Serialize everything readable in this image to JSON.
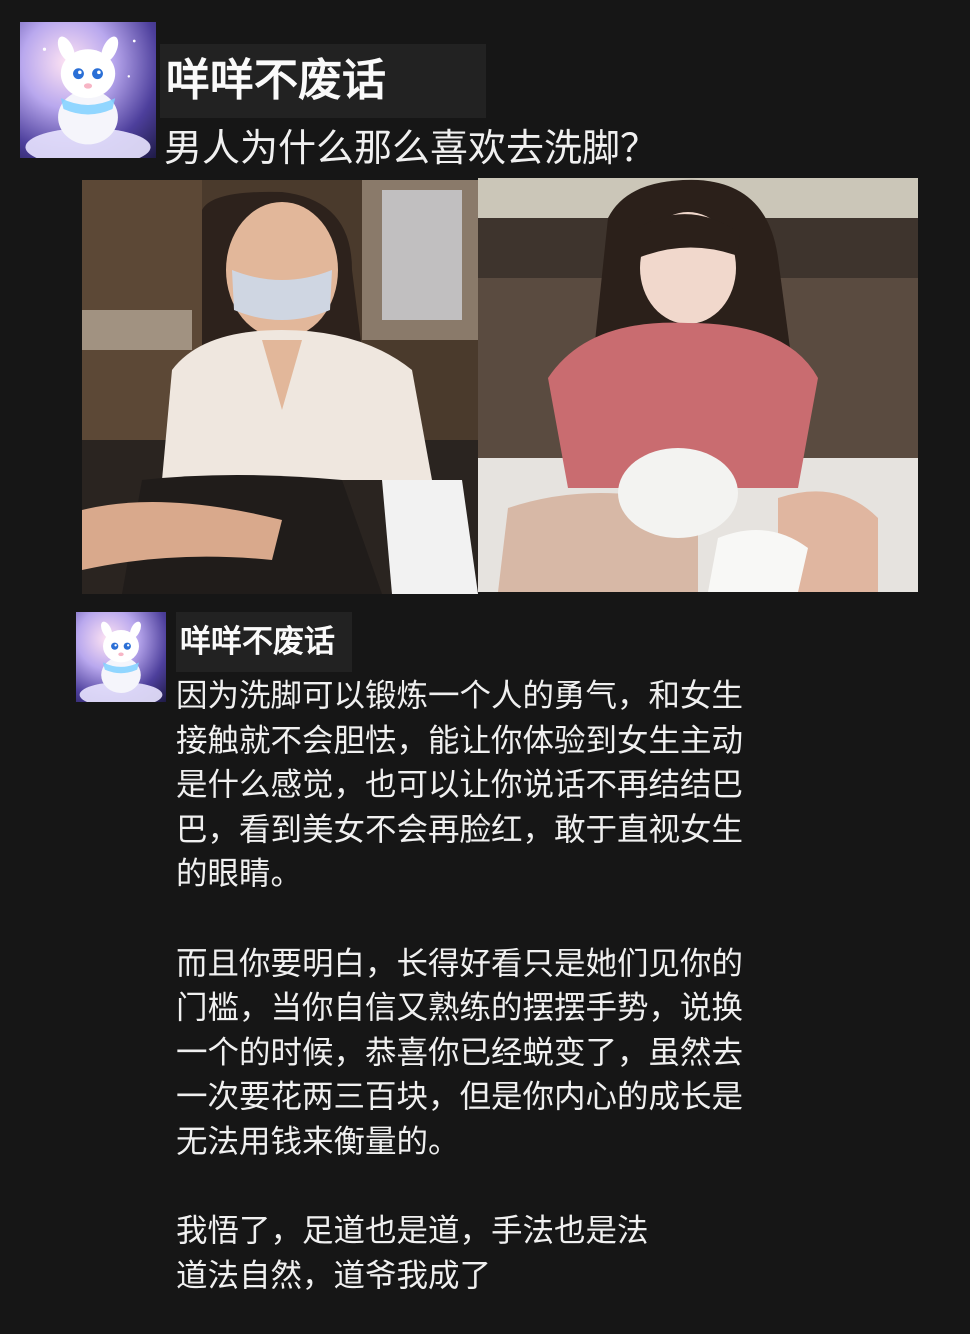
{
  "post": {
    "author_name": "咩咩不废话",
    "question": "男人为什么那么喜欢去洗脚？",
    "images": [
      {
        "icon": "photo-woman-masked-foot-massage"
      },
      {
        "icon": "photo-woman-pink-shirt-foot-massage"
      }
    ]
  },
  "reply": {
    "author_name": "咩咩不废话",
    "paragraphs": [
      {
        "lines": [
          "因为洗脚可以锻炼一个人的勇气，和女生",
          "接触就不会胆怯，能让你体验到女生主动",
          "是什么感觉，也可以让你说话不再结结巴",
          "巴，看到美女不会再脸红，敢于直视女生",
          "的眼睛。"
        ]
      },
      {
        "lines": [
          "而且你要明白，长得好看只是她们见你的",
          "门槛，当你自信又熟练的摆摆手势，说换",
          "一个的时候，恭喜你已经蜕变了，虽然去",
          "一次要花两三百块，但是你内心的成长是",
          "无法用钱来衡量的。"
        ]
      },
      {
        "lines": [
          "我悟了，足道也是道，手法也是法",
          "道法自然，道爷我成了"
        ]
      }
    ]
  },
  "colors": {
    "background": "#161616",
    "name_bar": "#222222",
    "text": "#f0f0f0"
  }
}
